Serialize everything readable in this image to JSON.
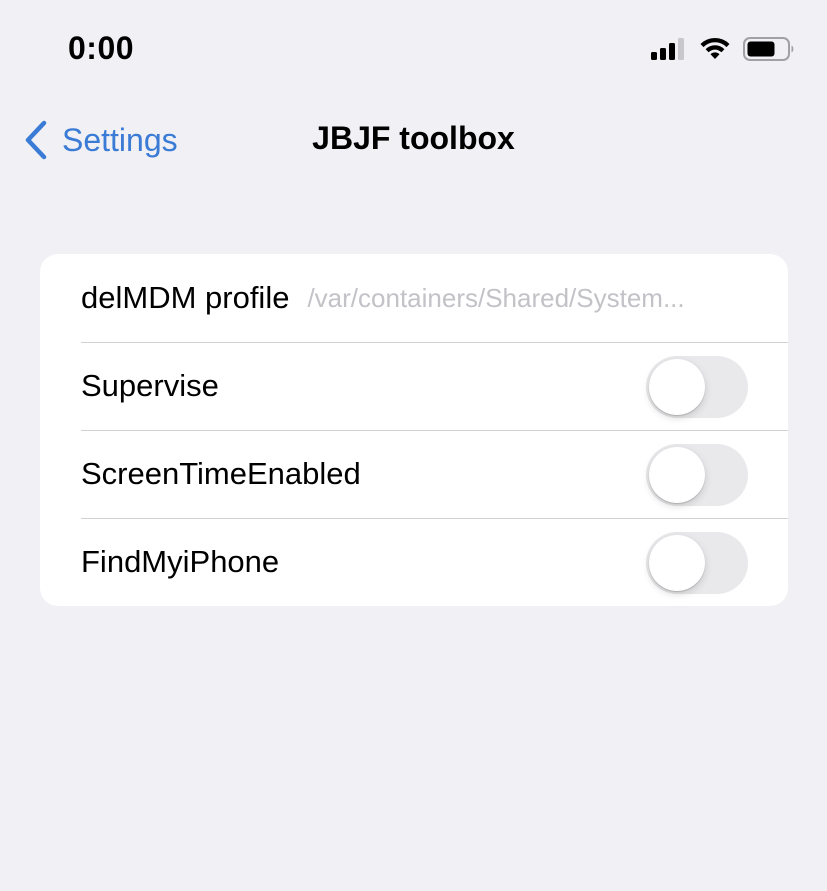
{
  "status_bar": {
    "time": "0:00",
    "icons": [
      "cellular-signal-icon",
      "wifi-icon",
      "battery-icon"
    ]
  },
  "nav": {
    "back_label": "Settings",
    "back_icon": "chevron-left-icon",
    "title": "JBJF toolbox",
    "accent_color": "#3a7bd5"
  },
  "settings": {
    "rows": [
      {
        "label": "delMDM profile",
        "value": "/var/containers/Shared/System..."
      },
      {
        "label": "Supervise",
        "toggle": false
      },
      {
        "label": "ScreenTimeEnabled",
        "toggle": false
      },
      {
        "label": "FindMyiPhone",
        "toggle": false
      }
    ]
  }
}
